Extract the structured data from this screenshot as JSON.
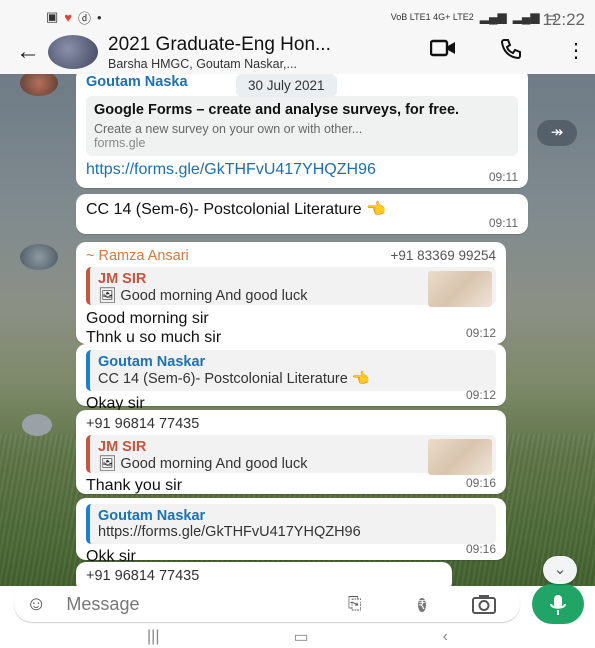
{
  "status_bar": {
    "time": "12:22",
    "right_text": "VoB LTE1 4G+ LTE2"
  },
  "header": {
    "back_icon": "arrow-left-icon",
    "title": "2021 Graduate-Eng Hon...",
    "subtitle": "Barsha HMGC, Goutam Naskar,..."
  },
  "chat": {
    "date_pill": "30 July 2021",
    "messages": [
      {
        "sender": "Goutam Naska",
        "preview_title": "Google Forms – create and analyse surveys, for free.",
        "preview_desc": "Create a new survey on your own or with other...",
        "preview_domain": "forms.gle",
        "link": "https://forms.gle/GkTHFvU417YHQZH96",
        "time": "09:11"
      },
      {
        "text": "CC 14 (Sem-6)- Postcolonial Literature 👈",
        "time": "09:11"
      },
      {
        "sender": "~ Ramza Ansari",
        "phone": "+91 83369 99254",
        "quote_name": "JM SIR",
        "quote_text": "🖼 Good morning And  good luck",
        "text_line1": "Good morning sir",
        "text_line2": "Thnk u so much sir",
        "time": "09:12"
      },
      {
        "quote_name": "Goutam Naskar",
        "quote_text": "CC 14 (Sem-6)- Postcolonial Literature 👈",
        "text": "Okay sir",
        "time": "09:12"
      },
      {
        "phone": "+91 96814 77435",
        "quote_name": "JM SIR",
        "quote_text": "🖼 Good morning And  good luck",
        "text": "Thank you sir",
        "time": "09:16"
      },
      {
        "quote_name": "Goutam Naskar",
        "quote_text": "https://forms.gle/GkTHFvU417YHQZH96",
        "text": "Okk sir",
        "time": "09:16"
      },
      {
        "phone": "+91 96814 77435"
      }
    ]
  },
  "input": {
    "placeholder": "Message"
  },
  "colors": {
    "accent_green": "#21a567",
    "link_blue": "#1a73b5",
    "quote_red": "#c6543f"
  }
}
